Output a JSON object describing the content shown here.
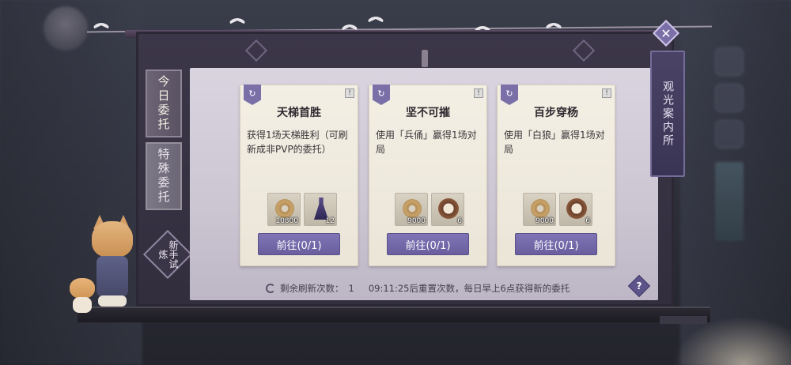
{
  "side_tabs": {
    "daily": "今日委托",
    "special": "特殊委托",
    "newbie": "新手试炼"
  },
  "banner": {
    "label": "观光案内所"
  },
  "cards": [
    {
      "title": "天梯首胜",
      "description": "获得1场天梯胜利（可刷新成非PVP的委托）",
      "rewards": [
        {
          "icon": "coin-icon",
          "count": "10800"
        },
        {
          "icon": "bottle-icon",
          "count": "12"
        }
      ],
      "button": "前往(0/1)"
    },
    {
      "title": "坚不可摧",
      "description": "使用「兵俑」赢得1场对局",
      "rewards": [
        {
          "icon": "coin-icon",
          "count": "9000"
        },
        {
          "icon": "drum-icon",
          "count": "6"
        }
      ],
      "button": "前往(0/1)"
    },
    {
      "title": "百步穿杨",
      "description": "使用「白狼」赢得1场对局",
      "rewards": [
        {
          "icon": "coin-icon",
          "count": "9000"
        },
        {
          "icon": "drum-icon",
          "count": "6"
        }
      ],
      "button": "前往(0/1)"
    }
  ],
  "footer": {
    "refresh_label": "剩余刷新次数：",
    "refresh_count": "1",
    "reset_text": "09:11:25后重置次数，每日早上6点获得新的委托"
  },
  "help": "?",
  "colors": {
    "accent": "#7b6fa8",
    "button": "#6a5f9e",
    "paper": "#f3efe4"
  }
}
